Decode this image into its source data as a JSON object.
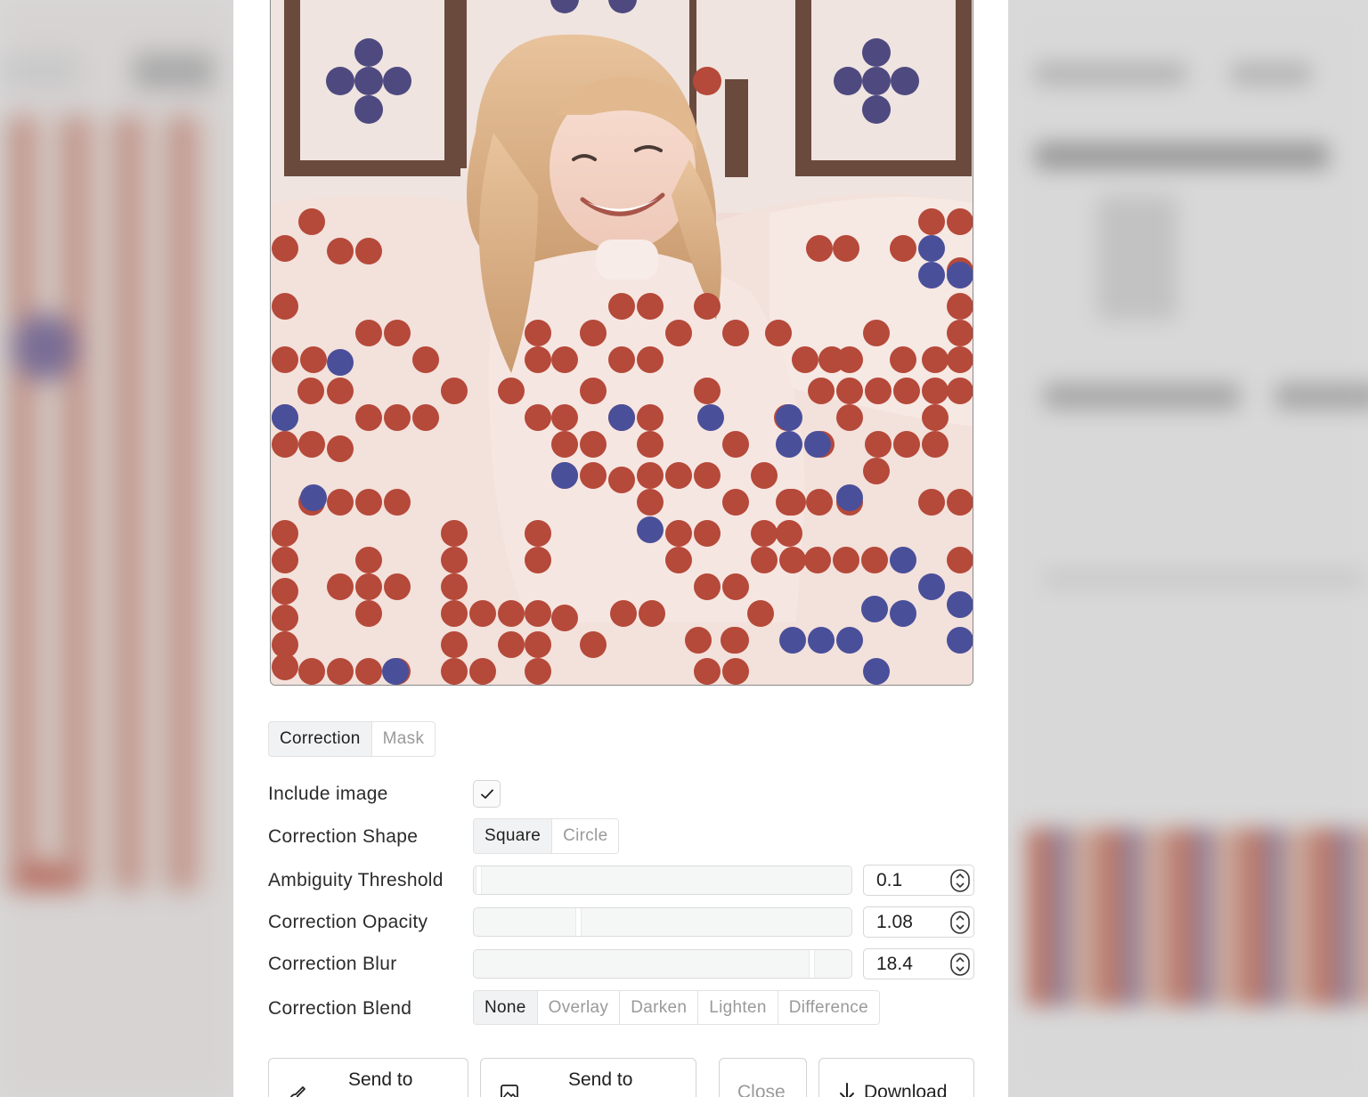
{
  "tabs": {
    "items": [
      "Correction",
      "Mask"
    ],
    "active": 0
  },
  "settings": {
    "include_image": {
      "label": "Include image",
      "checked": true
    },
    "correction_shape": {
      "label": "Correction Shape",
      "options": [
        "Square",
        "Circle"
      ],
      "active": 0
    },
    "ambiguity_threshold": {
      "label": "Ambiguity Threshold",
      "value": "0.1",
      "fraction": 0.0
    },
    "correction_opacity": {
      "label": "Correction Opacity",
      "value": "1.08",
      "fraction": 0.27
    },
    "correction_blur": {
      "label": "Correction Blur",
      "value": "18.4",
      "fraction": 0.9
    },
    "correction_blend": {
      "label": "Correction Blend",
      "options": [
        "None",
        "Overlay",
        "Darken",
        "Lighten",
        "Difference"
      ],
      "active": 0
    }
  },
  "actions": {
    "send_to_1": "Send to",
    "send_to_2": "Send to",
    "close": "Close",
    "download": "Download"
  },
  "icons": {
    "checkbox": "check-icon",
    "send1": "brush-icon",
    "send2": "image-icon",
    "download": "download-arrow-icon",
    "spinner": "stepper-icon"
  },
  "colors": {
    "dot_red": "#b5493a",
    "dot_blue": "#4a4f9a",
    "fabric": "#f1dcd5",
    "active_segment": "#f1f2f3"
  }
}
